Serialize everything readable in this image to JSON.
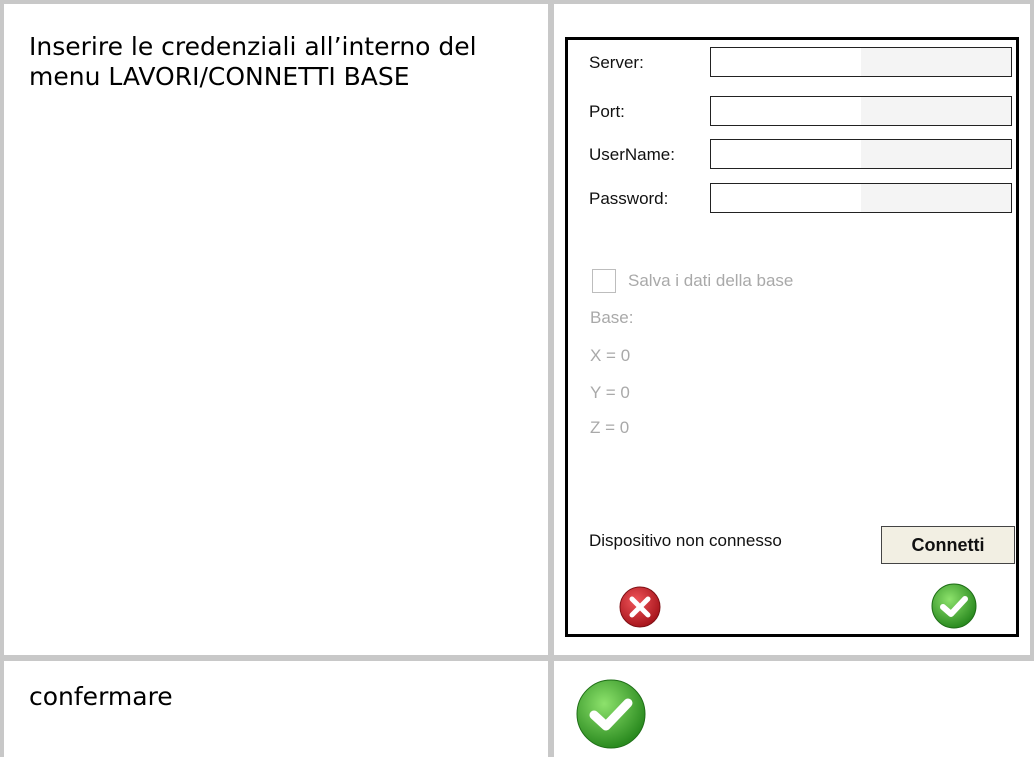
{
  "rows": [
    {
      "instruction": "Inserire le credenziali all’interno del menu LAVORI/CONNETTI BASE"
    },
    {
      "instruction": "confermare"
    }
  ],
  "device": {
    "fields": [
      {
        "label": "Server:",
        "value": ""
      },
      {
        "label": "Port:",
        "value": ""
      },
      {
        "label": "UserName:",
        "value": ""
      },
      {
        "label": "Password:",
        "value": ""
      }
    ],
    "save_checkbox_label": "Salva i dati della base",
    "save_checkbox_checked": false,
    "base_label": "Base:",
    "coords": [
      "X = 0",
      "Y = 0",
      "Z = 0"
    ],
    "status": "Dispositivo non connesso",
    "connect_label": "Connetti",
    "cancel_icon": "cancel-icon",
    "confirm_icon": "confirm-icon"
  },
  "colors": {
    "grid": "#c8c8c8",
    "cancel_red": "#c8242b",
    "confirm_green": "#3da32a",
    "disabled_text": "#a9a9a9"
  }
}
